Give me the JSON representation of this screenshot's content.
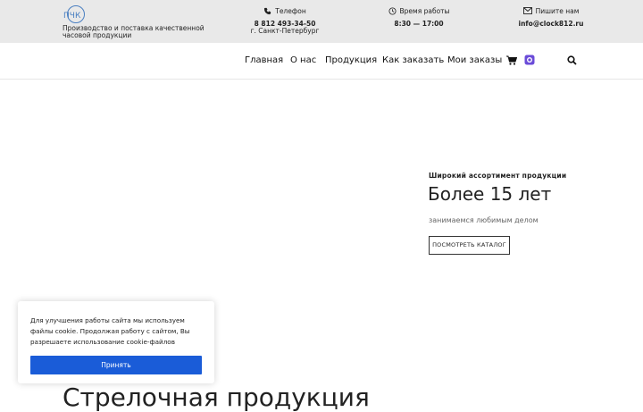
{
  "header": {
    "logo_text": "Производство и поставка качественной часовой продукции",
    "logo_mark": "ПЧК",
    "phone": {
      "label": "Телефон",
      "value": "8 812 493-34-50",
      "city": "г. Санкт-Петербург"
    },
    "hours": {
      "label": "Время работы",
      "value": "8:30 — 17:00"
    },
    "email": {
      "label": "Пишите нам",
      "value": "info@clock812.ru"
    }
  },
  "nav": {
    "items": [
      {
        "label": "Главная"
      },
      {
        "label": "О нас"
      },
      {
        "label": "Продукция"
      },
      {
        "label": "Как заказать"
      },
      {
        "label": "Мои заказы"
      }
    ],
    "icons": [
      "cart-icon",
      "calendar-icon",
      "search-icon"
    ]
  },
  "hero": {
    "eyebrow": "Широкий ассортимент продукции",
    "title": "Более 15 лет",
    "subtitle": "занимаемся любимым делом",
    "button": "ПОСМОТРЕТЬ КАТАЛОГ"
  },
  "section": {
    "title": "Стрелочная продукция"
  },
  "cookie": {
    "text": "Для улучшения работы сайта мы используем файлы cookie. Продолжая работу с сайтом, Вы разрешаете использование cookie-файлов",
    "accept": "Принять"
  },
  "colors": {
    "accent": "#1a5cd8",
    "topbar": "#e9e9e9",
    "logo": "#4a7fc1",
    "calendar": "#6a4bd8"
  }
}
